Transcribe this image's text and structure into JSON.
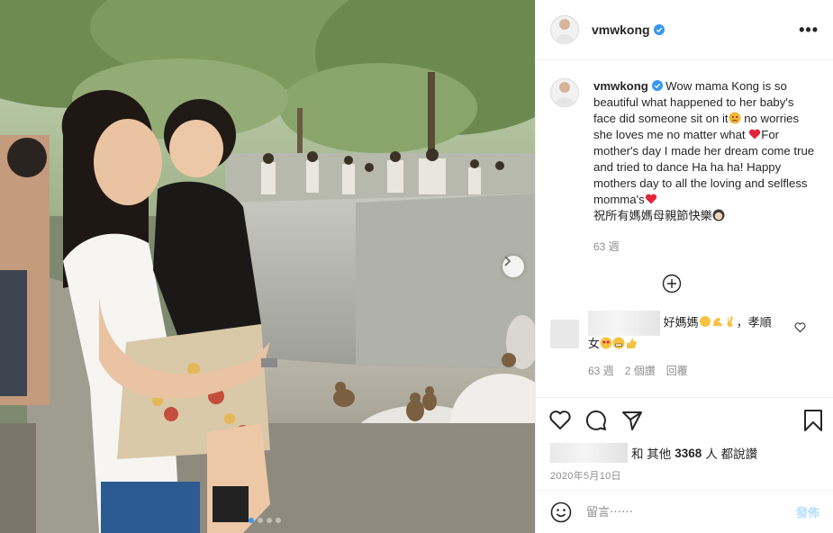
{
  "post": {
    "username": "vmwkong",
    "caption_text": "Wow mama Kong is so beautiful what happened to her baby's face did someone sit on it",
    "caption_text_2": "no worries she loves me no matter what",
    "caption_text_3": "For mother's day I made her dream come true and tried to dance Ha ha ha! Happy mothers day to all the loving and selfless momma's",
    "caption_text_4": "祝所有媽媽母親節快樂",
    "caption_age": "63 週",
    "date": "2020年5月10日"
  },
  "comment": {
    "text_1": "好媽媽",
    "text_2": "，孝順",
    "text_3": "女",
    "age": "63 週",
    "likes": "2 個讚",
    "reply": "回覆"
  },
  "likes": {
    "prefix": "和 其他",
    "count": "3368",
    "suffix": "人 都說讚"
  },
  "add_comment": {
    "placeholder": "留言⋯⋯",
    "post_label": "發佈"
  },
  "carousel": {
    "total": 4,
    "active": 0
  },
  "colors": {
    "accent": "#3897f0",
    "verified": "#3897f0",
    "muted": "#8e8e8e",
    "heart": "#ed4956"
  }
}
